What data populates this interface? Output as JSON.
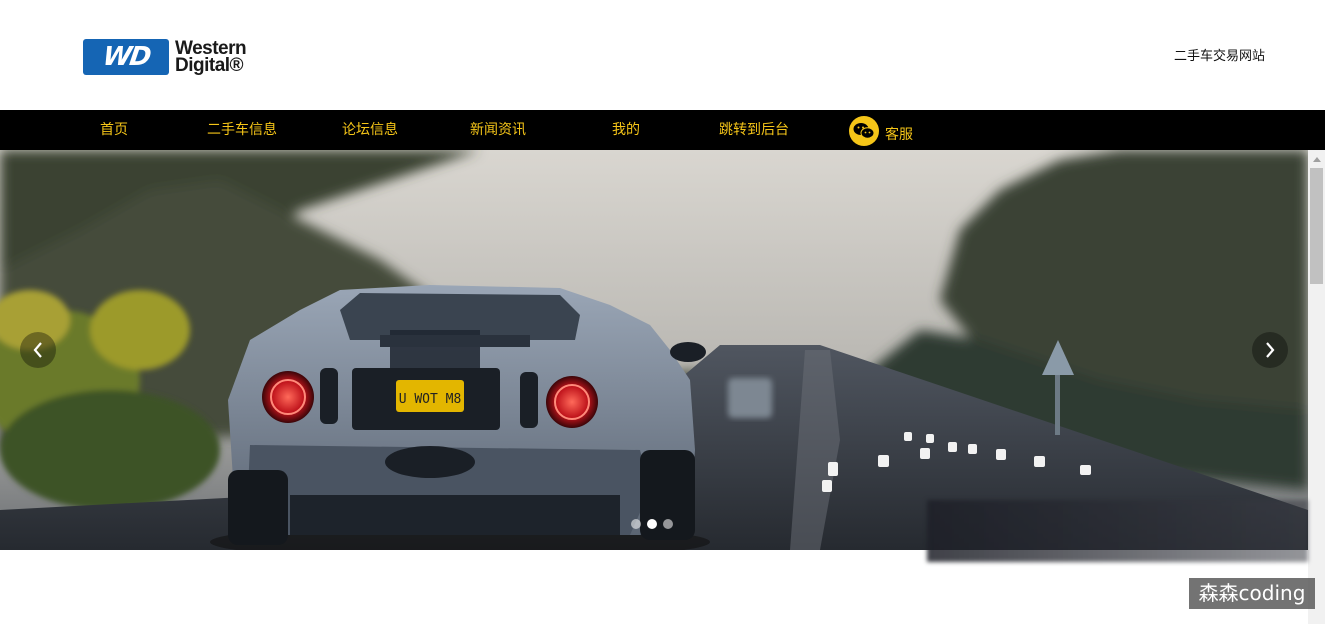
{
  "logo": {
    "badge_text": "WD",
    "word1": "Western",
    "word2": "Digital®"
  },
  "header": {
    "site_title": "二手车交易网站"
  },
  "nav": {
    "items": [
      {
        "label": "首页"
      },
      {
        "label": "二手车信息"
      },
      {
        "label": "论坛信息"
      },
      {
        "label": "新闻资讯"
      },
      {
        "label": "我的"
      },
      {
        "label": "跳转到后台"
      }
    ],
    "service_label": "客服"
  },
  "carousel": {
    "slide_count": 3,
    "active_slide": 2,
    "plate_text": "U WOT M8"
  },
  "watermark": {
    "text": "森森coding"
  },
  "colors": {
    "nav_bg": "#000000",
    "nav_text": "#f5c518",
    "logo_blue": "#1565b4"
  }
}
